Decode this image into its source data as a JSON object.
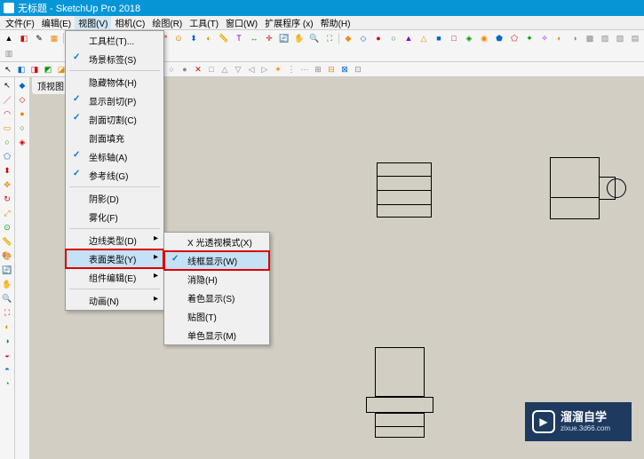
{
  "titlebar": {
    "title": "无标题 - SketchUp Pro 2018"
  },
  "menubar": {
    "items": [
      {
        "label": "文件(F)"
      },
      {
        "label": "编辑(E)"
      },
      {
        "label": "视图(V)",
        "active": true
      },
      {
        "label": "相机(C)"
      },
      {
        "label": "绘图(R)"
      },
      {
        "label": "工具(T)"
      },
      {
        "label": "窗口(W)"
      },
      {
        "label": "扩展程序 (x)"
      },
      {
        "label": "帮助(H)"
      }
    ]
  },
  "view_menu": {
    "items": [
      {
        "label": "工具栏(T)...",
        "arrow": false
      },
      {
        "label": "场景标签(S)",
        "check": true
      },
      {
        "sep": true
      },
      {
        "label": "隐藏物体(H)"
      },
      {
        "label": "显示剖切(P)",
        "check": true
      },
      {
        "label": "剖面切割(C)",
        "check": true
      },
      {
        "label": "剖面填充"
      },
      {
        "label": "坐标轴(A)",
        "check": true
      },
      {
        "label": "参考线(G)",
        "check": true
      },
      {
        "sep": true
      },
      {
        "label": "阴影(D)"
      },
      {
        "label": "雾化(F)"
      },
      {
        "sep": true
      },
      {
        "label": "边线类型(D)",
        "arrow": true
      },
      {
        "label": "表面类型(Y)",
        "arrow": true,
        "highlight": true
      },
      {
        "label": "组件编辑(E)",
        "arrow": true
      },
      {
        "sep": true
      },
      {
        "label": "动画(N)",
        "arrow": true
      }
    ]
  },
  "surface_submenu": {
    "items": [
      {
        "label": "X 光透视模式(X)"
      },
      {
        "sep": true
      },
      {
        "label": "线框显示(W)",
        "check": true,
        "highlight": true
      },
      {
        "label": "消隐(H)"
      },
      {
        "label": "着色显示(S)"
      },
      {
        "label": "贴图(T)"
      },
      {
        "label": "单色显示(M)"
      }
    ]
  },
  "viewtab": {
    "label": "顶视图"
  },
  "watermark": {
    "brand": "溜溜自学",
    "url": "zixue.3d66.com"
  }
}
